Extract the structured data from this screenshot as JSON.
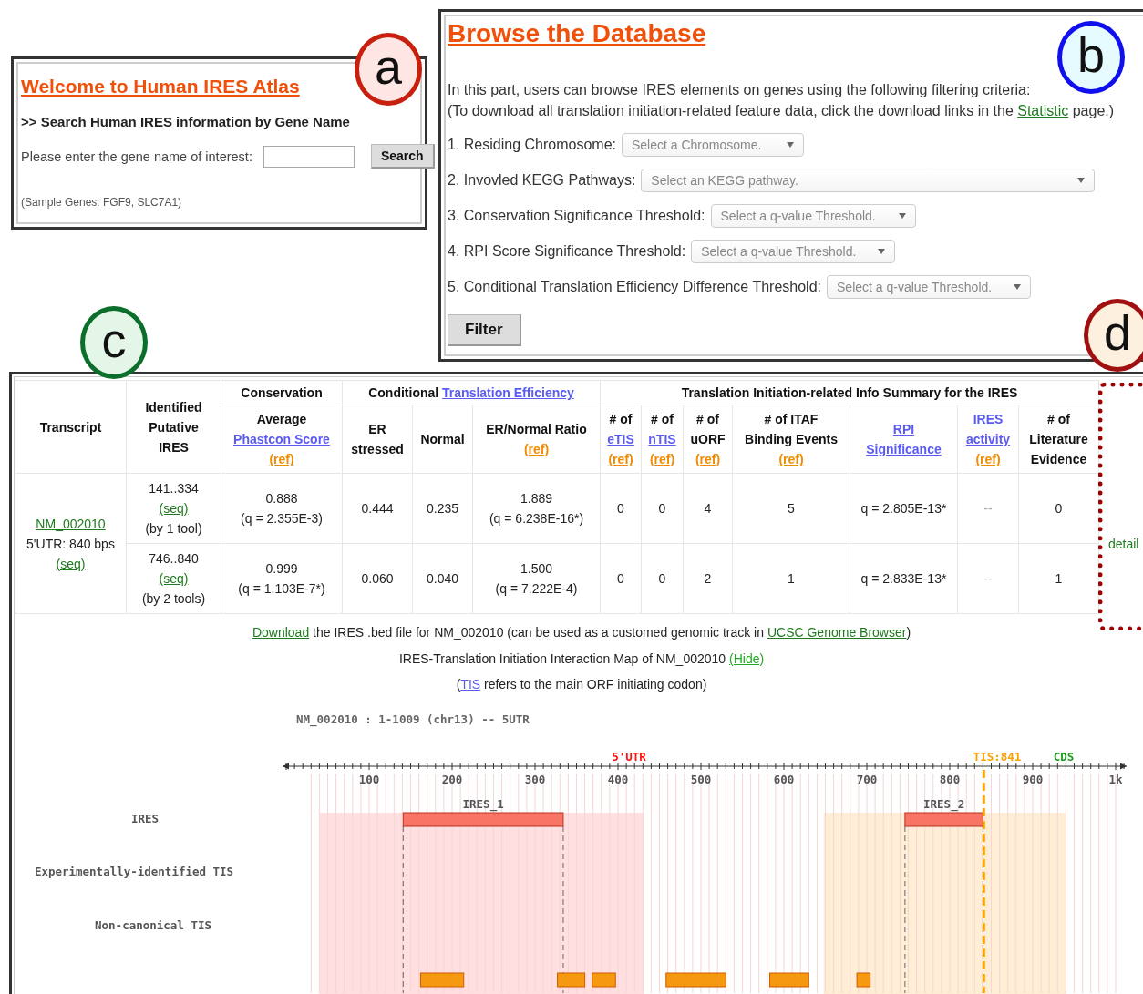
{
  "panel_labels": [
    {
      "letter": "a",
      "color": "#c8200e"
    },
    {
      "letter": "b",
      "color": "#1010ee"
    },
    {
      "letter": "c",
      "color": "#0b6e2a"
    },
    {
      "letter": "d",
      "color": "#a01010"
    }
  ],
  "search_panel": {
    "title": "Welcome to Human IRES Atlas",
    "heading": ">> Search Human IRES information by Gene Name",
    "prompt": "Please enter the gene name of interest:",
    "button": "Search",
    "note": "(Sample Genes: FGF9, SLC7A1)"
  },
  "browse_panel": {
    "title": "Browse the Database",
    "intro": "In this part, users can browse IRES elements on genes using the following filtering criteria:",
    "note": [
      {
        "text": "(To download all translation initiation-related feature data, click the download links in the ",
        "kind": "plain"
      },
      {
        "text": "Statistic",
        "kind": "green-link"
      },
      {
        "text": " page.)",
        "kind": "plain"
      }
    ],
    "filters": [
      {
        "label": "1. Residing Chromosome:",
        "placeholder": "Select a Chromosome."
      },
      {
        "label": "2. Invovled KEGG Pathways:",
        "placeholder": "Select an KEGG pathway."
      },
      {
        "label": "3. Conservation Significance Threshold:",
        "placeholder": "Select a q-value Threshold."
      },
      {
        "label": "4. RPI Score Significance Threshold:",
        "placeholder": "Select a q-value Threshold."
      },
      {
        "label": "5. Conditional Translation Efficiency Difference Threshold:",
        "placeholder": "Select a q-value Threshold."
      }
    ],
    "button": "Filter"
  },
  "results_panel": {
    "table": {
      "headers": [
        {
          "lines": [
            {
              "text": "Transcript",
              "kind": "plain"
            }
          ]
        },
        {
          "lines": [
            {
              "text": "Identified",
              "kind": "plain"
            },
            {
              "text": "Putative",
              "kind": "plain"
            },
            {
              "text": "IRES",
              "kind": "plain"
            }
          ]
        },
        {
          "title": [
            {
              "text": "Conservation",
              "kind": "plain"
            }
          ],
          "columns": [
            {
              "lines": [
                {
                  "text": "Average",
                  "kind": "plain"
                },
                {
                  "text": "Phastcon Score",
                  "kind": "blue-link"
                },
                {
                  "text": "(ref)",
                  "kind": "orange-link"
                }
              ]
            }
          ]
        },
        {
          "title": [
            {
              "text": "Conditional ",
              "kind": "plain"
            },
            {
              "text": "Translation Efficiency",
              "kind": "blue-link"
            }
          ],
          "columns": [
            {
              "lines": [
                {
                  "text": "ER",
                  "kind": "plain"
                },
                {
                  "text": "stressed",
                  "kind": "plain"
                }
              ]
            },
            {
              "lines": [
                {
                  "text": "Normal",
                  "kind": "plain"
                }
              ]
            },
            {
              "lines": [
                {
                  "text": "ER/Normal Ratio",
                  "kind": "plain"
                },
                {
                  "text": "(ref)",
                  "kind": "orange-link"
                }
              ]
            }
          ]
        },
        {
          "title": [
            {
              "text": "Translation Initiation-related Info Summary for the IRES",
              "kind": "plain"
            }
          ],
          "columns": [
            {
              "lines": [
                {
                  "text": "# of",
                  "kind": "plain"
                },
                {
                  "text": "eTIS",
                  "kind": "blue-link"
                },
                {
                  "text": "(ref)",
                  "kind": "orange-link"
                }
              ]
            },
            {
              "lines": [
                {
                  "text": "# of",
                  "kind": "plain"
                },
                {
                  "text": "nTIS",
                  "kind": "blue-link"
                },
                {
                  "text": "(ref)",
                  "kind": "orange-link"
                }
              ]
            },
            {
              "lines": [
                {
                  "text": "# of",
                  "kind": "plain"
                },
                {
                  "text": "uORF",
                  "kind": "plain"
                },
                {
                  "text": "(ref)",
                  "kind": "orange-link"
                }
              ]
            },
            {
              "lines": [
                {
                  "text": "# of ITAF",
                  "kind": "plain"
                },
                {
                  "text": "Binding Events",
                  "kind": "plain"
                },
                {
                  "text": "(ref)",
                  "kind": "orange-link"
                }
              ]
            },
            {
              "lines": [
                {
                  "text": "RPI",
                  "kind": "blue-link"
                },
                {
                  "text": "Significance",
                  "kind": "blue-link"
                }
              ]
            },
            {
              "lines": [
                {
                  "text": "IRES",
                  "kind": "blue-link"
                },
                {
                  "text": "activity",
                  "kind": "blue-link"
                },
                {
                  "text": "(ref)",
                  "kind": "orange-link"
                }
              ]
            },
            {
              "lines": [
                {
                  "text": "# of",
                  "kind": "plain"
                },
                {
                  "text": "Literature",
                  "kind": "plain"
                },
                {
                  "text": "Evidence",
                  "kind": "plain"
                }
              ]
            }
          ]
        }
      ],
      "transcript": [
        {
          "text": "NM_002010",
          "kind": "green-link"
        },
        {
          "text": "5'UTR: 840 bps",
          "kind": "plain"
        },
        {
          "text": "(seq)",
          "kind": "green-link"
        }
      ],
      "detail_link": "detail",
      "rows": [
        {
          "ires": [
            {
              "text": "141..334",
              "kind": "plain"
            },
            {
              "text": "(seq)",
              "kind": "green-link"
            },
            {
              "text": "(by 1 tool)",
              "kind": "plain"
            }
          ],
          "cells": [
            {
              "text": "0.888\n(q = 2.355E-3)",
              "muted": false
            },
            {
              "text": "0.444",
              "muted": false
            },
            {
              "text": "0.235",
              "muted": false
            },
            {
              "text": "1.889\n(q = 6.238E-16*)",
              "muted": false
            },
            {
              "text": "0",
              "muted": false
            },
            {
              "text": "0",
              "muted": false
            },
            {
              "text": "4",
              "muted": false
            },
            {
              "text": "5",
              "muted": false
            },
            {
              "text": "q = 2.805E-13*",
              "muted": false
            },
            {
              "text": "--",
              "muted": true
            },
            {
              "text": "0",
              "muted": false
            }
          ]
        },
        {
          "ires": [
            {
              "text": "746..840",
              "kind": "plain"
            },
            {
              "text": "(seq)",
              "kind": "green-link"
            },
            {
              "text": "(by 2 tools)",
              "kind": "plain"
            }
          ],
          "cells": [
            {
              "text": "0.999\n(q = 1.103E-7*)",
              "muted": false
            },
            {
              "text": "0.060",
              "muted": false
            },
            {
              "text": "0.040",
              "muted": false
            },
            {
              "text": "1.500\n(q = 7.222E-4)",
              "muted": false
            },
            {
              "text": "0",
              "muted": false
            },
            {
              "text": "0",
              "muted": false
            },
            {
              "text": "2",
              "muted": false
            },
            {
              "text": "1",
              "muted": false
            },
            {
              "text": "q = 2.833E-13*",
              "muted": false
            },
            {
              "text": "--",
              "muted": true
            },
            {
              "text": "1",
              "muted": false
            }
          ]
        }
      ]
    },
    "notes": [
      [
        {
          "text": "Download",
          "kind": "green-link"
        },
        {
          "text": " the IRES .bed file for NM_002010 (can be used as a customed genomic track in ",
          "kind": "plain"
        },
        {
          "text": "UCSC Genome Browser",
          "kind": "green-link"
        },
        {
          "text": ")",
          "kind": "plain"
        }
      ],
      [
        {
          "text": "IRES-Translation Initiation Interaction Map of NM_002010 ",
          "kind": "plain"
        },
        {
          "text": "(Hide)",
          "kind": "light-green-link"
        }
      ],
      [
        {
          "text": "(",
          "kind": "plain"
        },
        {
          "text": "TIS",
          "kind": "blue-link"
        },
        {
          "text": " refers to the main ORF initiating codon)",
          "kind": "plain"
        }
      ]
    ],
    "map": {
      "title": "NM_002010 : 1-1009 (chr13) -- 5UTR",
      "region_labels": [
        {
          "text": "5'UTR",
          "color": "#ff1010"
        },
        {
          "text": "TIS:841",
          "color": "#ffa000"
        },
        {
          "text": "CDS",
          "color": "#1a9a1a"
        }
      ],
      "ticks": [
        "100",
        "200",
        "300",
        "400",
        "500",
        "600",
        "700",
        "800",
        "900",
        "1k"
      ],
      "tracks": [
        "IRES",
        "Experimentally-identified TIS",
        "Non-canonical TIS"
      ],
      "features": [
        "IRES_1",
        "IRES_2"
      ]
    }
  }
}
